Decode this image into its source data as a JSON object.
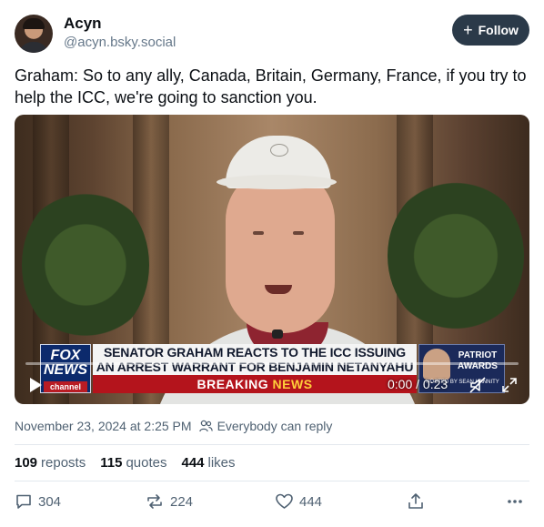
{
  "author": {
    "display_name": "Acyn",
    "handle": "@acyn.bsky.social",
    "avatar_icon": "avatar-photo"
  },
  "follow_button": {
    "icon": "plus-icon",
    "label": "Follow"
  },
  "post_text": "Graham: So to any ally, Canada, Britain, Germany, France, if you try to help the ICC, we're going to sanction you.",
  "video": {
    "lower_third": {
      "logo_line1": "FOX",
      "logo_line2": "NEWS",
      "logo_line3": "channel",
      "headline_line1": "SENATOR GRAHAM REACTS TO THE ICC ISSUING",
      "headline_line2": "AN ARREST WARRANT FOR BENJAMIN NETANYAHU",
      "banner_word1": "BREAKING",
      "banner_word2": "NEWS",
      "promo_line1": "PATRIOT",
      "promo_line2": "AWARDS",
      "promo_sub": "HOSTED BY SEAN HANNITY"
    },
    "time": "0:00 / 0:23",
    "progress": 0,
    "play_icon": "play-icon",
    "mute_icon": "muted-speaker-icon",
    "fullscreen_icon": "fullscreen-icon"
  },
  "meta": {
    "timestamp": "November 23, 2024 at 2:25 PM",
    "reply_setting": "Everybody can reply",
    "reply_icon": "people-icon"
  },
  "stats": {
    "reposts_count": "109",
    "reposts_label": "reposts",
    "quotes_count": "115",
    "quotes_label": "quotes",
    "likes_count": "444",
    "likes_label": "likes"
  },
  "actions": {
    "reply_count": "304",
    "repost_count": "224",
    "like_count": "444"
  },
  "colors": {
    "follow_bg": "#2b3a49",
    "muted_text": "#4f6172",
    "breaking_red": "#b4141c"
  }
}
